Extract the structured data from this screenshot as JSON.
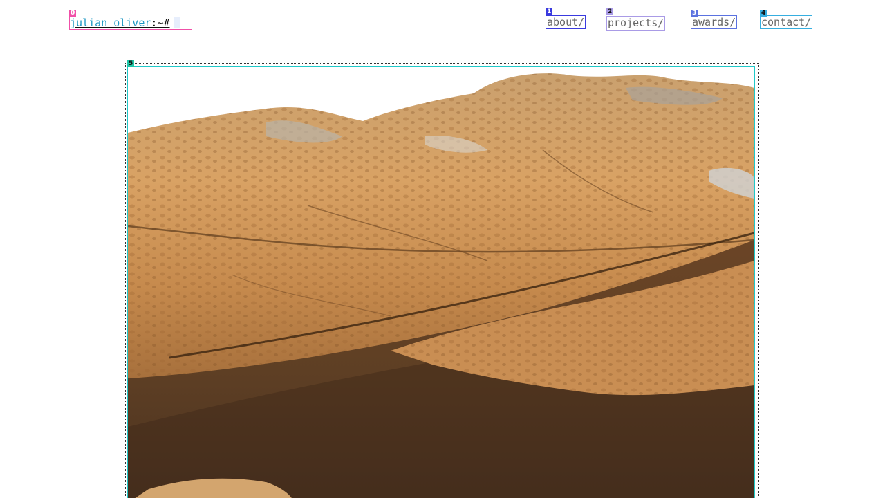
{
  "header": {
    "prompt_name": "julian oliver",
    "prompt_suffix": ":~#"
  },
  "nav": [
    {
      "label": "about/"
    },
    {
      "label": "projects/"
    },
    {
      "label": "awards/"
    },
    {
      "label": "contact/"
    }
  ],
  "markers": [
    "0",
    "1",
    "2",
    "3",
    "4",
    "5"
  ],
  "marker_colors": [
    "#f050a8",
    "#3a3adf",
    "#a99be6",
    "#5b72e0",
    "#36aee0",
    "#1fc6a6"
  ],
  "featured_image": {
    "subject": "sandstone rock formation over water",
    "icon": "rock-photo-icon"
  },
  "colors": {
    "prompt_name": "#1f98c4",
    "nav_text": "#666666",
    "rock_light": "#d9a264",
    "rock_dark": "#8a5a2e",
    "water": "#5e3f24"
  }
}
